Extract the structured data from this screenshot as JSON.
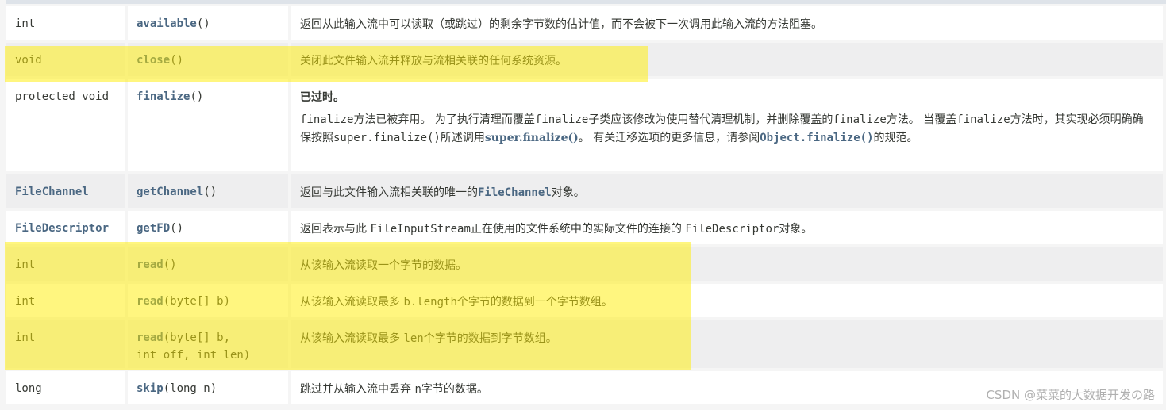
{
  "rows": [
    {
      "type": "int",
      "method": "available",
      "params": "()",
      "desc": "返回从此输入流中可以读取（或跳过）的剩余字节数的估计值，而不会被下一次调用此输入流的方法阻塞。"
    },
    {
      "type": "void",
      "method": "close",
      "params": "()",
      "desc": "关闭此文件输入流并释放与流相关联的任何系统资源。"
    },
    {
      "type": "protected void",
      "method": "finalize",
      "params": "()",
      "deprecated": "已过时。",
      "desc_parts": [
        "finalize",
        "方法已被弃用。 为了执行清理而覆盖",
        "finalize",
        "子类应该修改为使用替代清理机制，并删除覆盖的",
        "finalize",
        "方法。 当覆盖",
        "finalize",
        "方法时，其实现必须明确确保按照",
        "super.finalize()",
        "所述调用",
        "super.finalize()",
        "。 有关迁移选项的更多信息，请参阅",
        "Object.finalize()",
        "的规范。"
      ]
    },
    {
      "type": "FileChannel",
      "method": "getChannel",
      "params": "()",
      "desc_pre": "返回与此文件输入流相关联的唯一的",
      "desc_code": "FileChannel",
      "desc_post": "对象。"
    },
    {
      "type": "FileDescriptor",
      "method": "getFD",
      "params": "()",
      "desc_pre": "返回表示与此 ",
      "desc_code": "FileInputStream",
      "desc_mid": "正在使用的文件系统中的实际文件的连接的 ",
      "desc_code2": "FileDescriptor",
      "desc_post": "对象。"
    },
    {
      "type": "int",
      "method": "read",
      "params": "()",
      "desc": "从该输入流读取一个字节的数据。"
    },
    {
      "type": "int",
      "method": "read",
      "params": "(byte[] b)",
      "desc_pre": "从该输入流读取最多 ",
      "desc_code": "b.length",
      "desc_post": "个字节的数据到一个字节数组。"
    },
    {
      "type": "int",
      "method": "read",
      "params": "(byte[] b,",
      "params2": "int off, int len)",
      "desc_pre": "从该输入流读取最多 ",
      "desc_code": "len",
      "desc_post": "个字节的数据到字节数组。"
    },
    {
      "type": "long",
      "method": "skip",
      "params": "(long n)",
      "desc_pre": "跳过并从输入流中丢弃 ",
      "desc_code": "n",
      "desc_post": "字节的数据。"
    }
  ],
  "highlight_color": "#fff000",
  "watermark": "CSDN @菜菜的大数据开发の路"
}
